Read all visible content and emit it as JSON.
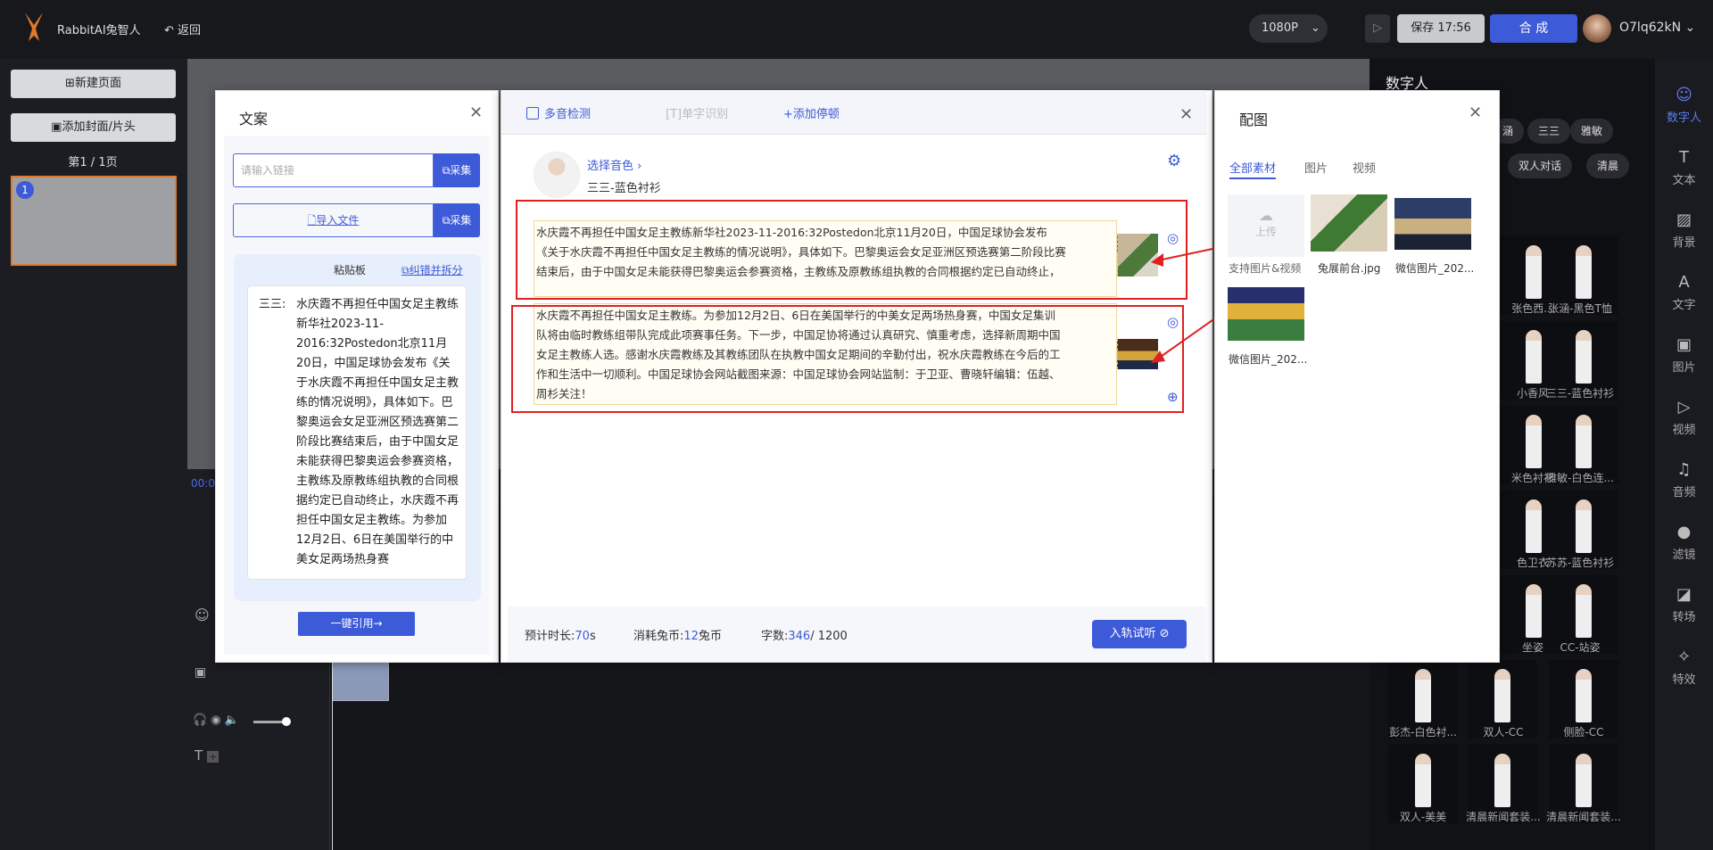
{
  "app": {
    "name": "RabbitAI兔智人",
    "back": "返回",
    "resolution": "1080P",
    "save": "保存",
    "save_time": "17:56",
    "compose": "合 成",
    "user": "O7lq62kN"
  },
  "left": {
    "new_page": "新建页面",
    "add_cover": "添加封面/片头",
    "page_indicator": "第1 / 1页",
    "thumb_num": "1"
  },
  "timeline": {
    "time": "00:0"
  },
  "copy_panel": {
    "title": "文案",
    "link_placeholder": "请输入链接",
    "collect": "采集",
    "import_file": "导入文件",
    "clipboard_title": "粘贴板",
    "fix_split": "纠错并拆分",
    "speaker": "三三:",
    "text": "水庆霞不再担任中国女足主教练新华社2023-11-2016:32Postedon北京11月20日，中国足球协会发布《关于水庆霞不再担任中国女足主教练的情况说明》，具体如下。巴黎奥运会女足亚洲区预选赛第二阶段比赛结束后，由于中国女足未能获得巴黎奥运会参赛资格，主教练及原教练组执教的合同根据约定已自动终止，水庆霞不再担任中国女足主教练。为参加12月2日、6日在美国举行的中美女足两场热身赛",
    "quote_all": "一键引用→"
  },
  "editor": {
    "multi_tone": "多音检测",
    "single_char": "单字识别",
    "add_pause": "+添加停顿",
    "select_voice": "选择音色 ›",
    "voice_name": "三三-蓝色衬衫",
    "seg1": "水庆霞不再担任中国女足主教练新华社2023-11-2016:32Postedon北京11月20日，中国足球协会发布《关于水庆霞不再担任中国女足主教练的情况说明》，具体如下。巴黎奥运会女足亚洲区预选赛第二阶段比赛结束后，由于中国女足未能获得巴黎奥运会参赛资格，主教练及原教练组执教的合同根据约定已自动终止，",
    "seg2": "水庆霞不再担任中国女足主教练。为参加12月2日、6日在美国举行的中美女足两场热身赛，中国女足集训队将由临时教练组带队完成此项赛事任务。下一步，中国足协将通过认真研究、慎重考虑，选择新周期中国女足主教练人选。感谢水庆霞教练及其教练团队在执教中国女足期间的辛勤付出，祝水庆霞教练在今后的工作和生活中一切顺利。中国足球协会网站截图来源：中国足球协会网站监制：于卫亚、曹晓轩编辑：伍越、周杉关注！",
    "est_label": "预计时长:",
    "est_val": "70",
    "est_unit": "s",
    "coin_label": "消耗兔币:",
    "coin_val": "12",
    "coin_unit": "兔币",
    "count_label": "字数:",
    "count_val": "346",
    "count_max": "/ 1200",
    "listen": "入轨试听"
  },
  "media_panel": {
    "title": "配图",
    "tabs": [
      "全部素材",
      "图片",
      "视频"
    ],
    "upload": "上传",
    "upload_hint": "支持图片&视频",
    "items": [
      "兔展前台.jpg",
      "微信图片_202...",
      "微信图片_202..."
    ]
  },
  "digital": {
    "title": "数字人",
    "chips": [
      "涵",
      "三三",
      "雅敏",
      "双人对话",
      "清晨"
    ],
    "labels": [
      "张色西...",
      "张涵-黑色T恤",
      "小香风",
      "三三-蓝色衬衫",
      "米色衬衫",
      "雅敏-白色连...",
      "色卫衣",
      "苏苏-蓝色衬衫",
      "坐姿",
      "CC-站姿",
      "彭杰-白色衬...",
      "双人-CC",
      "侧脸-CC",
      "双人-美美",
      "清晨新闻套装...",
      "清晨新闻套装..."
    ]
  },
  "sidebar": [
    "数字人",
    "文本",
    "背景",
    "文字",
    "图片",
    "视频",
    "音频",
    "滤镜",
    "转场",
    "特效"
  ]
}
